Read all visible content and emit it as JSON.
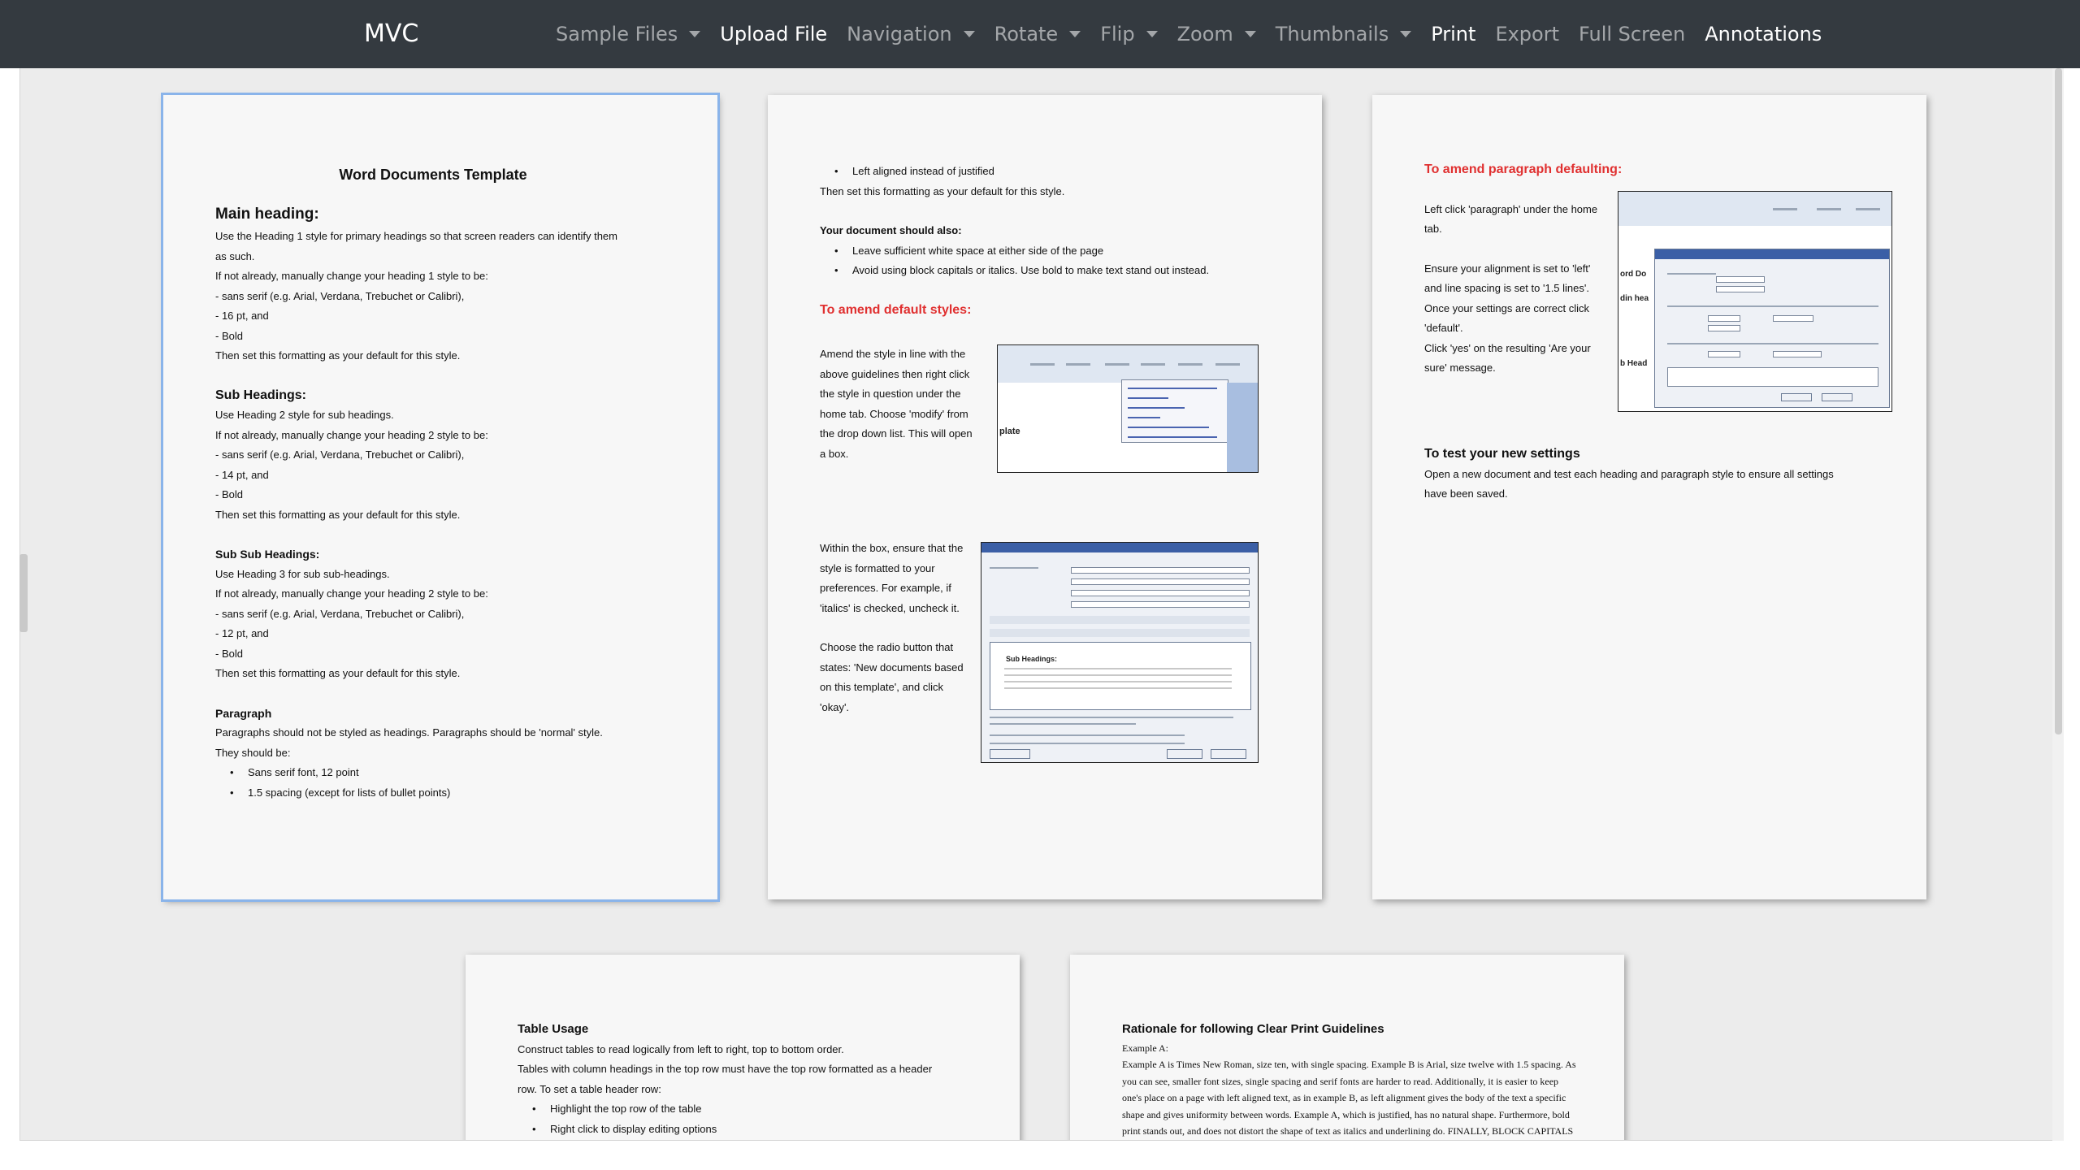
{
  "navbar": {
    "brand": "MVC",
    "items": [
      {
        "label": "Sample Files",
        "dropdown": true,
        "active": false
      },
      {
        "label": "Upload File",
        "dropdown": false,
        "active": true
      },
      {
        "label": "Navigation",
        "dropdown": true,
        "active": false
      },
      {
        "label": "Rotate",
        "dropdown": true,
        "active": false
      },
      {
        "label": "Flip",
        "dropdown": true,
        "active": false
      },
      {
        "label": "Zoom",
        "dropdown": true,
        "active": false
      },
      {
        "label": "Thumbnails",
        "dropdown": true,
        "active": false
      },
      {
        "label": "Print",
        "dropdown": false,
        "active": true
      },
      {
        "label": "Export",
        "dropdown": false,
        "active": false
      },
      {
        "label": "Full Screen",
        "dropdown": false,
        "active": false
      },
      {
        "label": "Annotations",
        "dropdown": false,
        "active": true
      }
    ]
  },
  "page1": {
    "title": "Word Documents Template",
    "main_heading": "Main heading:",
    "main_lines": [
      "Use the Heading 1 style for primary headings so that screen readers can identify them",
      "as such.",
      "If not already, manually change your heading 1 style to be:",
      " - sans serif (e.g. Arial, Verdana, Trebuchet or Calibri),",
      " - 16 pt, and",
      " - Bold",
      "Then set this formatting as your default for this style."
    ],
    "sub_heading": "Sub Headings:",
    "sub_lines": [
      "Use Heading 2 style for sub headings.",
      "If not already, manually change your heading 2 style to be:",
      " - sans serif (e.g. Arial, Verdana, Trebuchet or Calibri),",
      " - 14 pt, and",
      " - Bold",
      "Then set this formatting as your default for this style."
    ],
    "subsub_heading": "Sub Sub Headings:",
    "subsub_lines": [
      "Use Heading 3 for sub sub-headings.",
      "If not already, manually change your heading 2 style to be:",
      " - sans serif (e.g. Arial, Verdana, Trebuchet or Calibri),",
      " - 12 pt, and",
      " - Bold",
      "Then set this formatting as your default for this style."
    ],
    "para_heading": "Paragraph",
    "para_lines": [
      "Paragraphs should not be styled as headings. Paragraphs should be 'normal' style.",
      "They should be:"
    ],
    "para_bullets": [
      "Sans serif font, 12 point",
      "1.5 spacing (except for lists of bullet points)"
    ]
  },
  "page2": {
    "top_bullet": "Left aligned instead of justified",
    "top_line": "Then set this formatting as your default for this style.",
    "also_heading": "Your document should also:",
    "also_bullets": [
      "Leave sufficient white space at either side of the page",
      "Avoid using block capitals or italics. Use bold to make text stand out instead."
    ],
    "amend_heading": "To amend default styles:",
    "amend_lines": [
      "Amend the style in line with the",
      "above guidelines then right click",
      "the style in question under the",
      "home tab. Choose 'modify' from",
      "the drop down list. This will open",
      "a box."
    ],
    "shot1_label": "plate",
    "within_lines": [
      "Within the box, ensure that the",
      "style is formatted to your",
      "preferences. For example, if",
      "'italics' is checked, uncheck it."
    ],
    "radio_lines": [
      "Choose the radio button that",
      "states: 'New documents based",
      "on this template', and click",
      "'okay'."
    ],
    "shot2_label": "Sub Headings:"
  },
  "page3": {
    "para_heading": "To amend paragraph defaulting:",
    "left_lines": [
      "Left click 'paragraph' under the home",
      "tab."
    ],
    "ensure_lines": [
      "Ensure your alignment is set to 'left'",
      "and line spacing is set to '1.5 lines'.",
      "Once your settings are correct click",
      "'default'.",
      "Click 'yes' on the resulting 'Are your",
      "sure' message."
    ],
    "test_heading": "To test your new settings",
    "test_lines": [
      "Open a new document and test each heading and paragraph style to ensure all settings",
      "have been saved."
    ]
  },
  "page4": {
    "heading": "Table Usage",
    "lines": [
      "Construct tables to read logically from left to right, top to bottom order.",
      "Tables with column headings in the top row must have the top row formatted as a header",
      "row. To set a table header row:"
    ],
    "bullets": [
      "Highlight the top row of the table",
      "Right click to display editing options"
    ]
  },
  "page5": {
    "heading": "Rationale for following Clear Print Guidelines",
    "example": "Example A:",
    "lines": [
      "Example A is Times New Roman, size ten, with single spacing. Example B is Arial, size twelve with 1.5 spacing. As",
      "you can see, smaller font sizes, single spacing and serif fonts are harder to read. Additionally, it is easier to keep",
      "one's place on a page with left aligned text, as in example B, as left alignment gives the body of the text a specific",
      "shape and gives uniformity between words. Example A, which is justified, has no natural shape. Furthermore, bold",
      "print stands out, and does not distort the shape of text as italics and underlining do. FINALLY, BLOCK CAPITALS"
    ]
  },
  "colors": {
    "navbar_bg": "#343a40",
    "viewer_bg": "#ececec",
    "page_bg": "#f7f7f7",
    "red_heading": "#e03030",
    "selection": "#8ab4ea"
  }
}
